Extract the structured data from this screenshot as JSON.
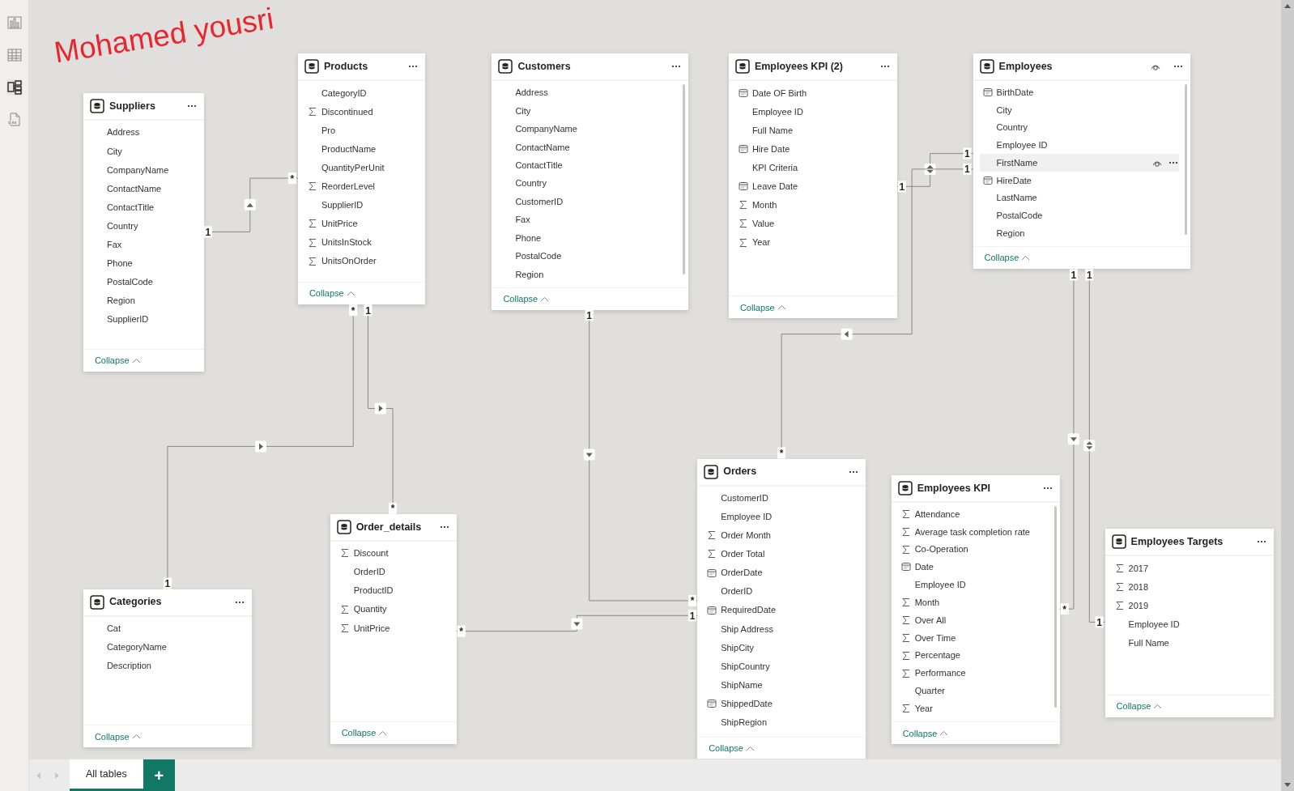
{
  "signature": "Mohamed yousri",
  "sidebar": [
    {
      "kind": "report",
      "selected": false
    },
    {
      "kind": "table",
      "selected": false
    },
    {
      "kind": "model",
      "selected": true
    },
    {
      "kind": "dax",
      "selected": false
    }
  ],
  "tables": [
    {
      "title": "Suppliers",
      "hovered": false,
      "scrollable": false,
      "collapse_label": "Collapse",
      "fields": [
        {
          "name": "Address",
          "kind": "plain",
          "hovered": false
        },
        {
          "name": "City",
          "kind": "plain",
          "hovered": false
        },
        {
          "name": "CompanyName",
          "kind": "plain",
          "hovered": false
        },
        {
          "name": "ContactName",
          "kind": "plain",
          "hovered": false
        },
        {
          "name": "ContactTitle",
          "kind": "plain",
          "hovered": false
        },
        {
          "name": "Country",
          "kind": "plain",
          "hovered": false
        },
        {
          "name": "Fax",
          "kind": "plain",
          "hovered": false
        },
        {
          "name": "Phone",
          "kind": "plain",
          "hovered": false
        },
        {
          "name": "PostalCode",
          "kind": "plain",
          "hovered": false
        },
        {
          "name": "Region",
          "kind": "plain",
          "hovered": false
        },
        {
          "name": "SupplierID",
          "kind": "plain",
          "hovered": false
        }
      ]
    },
    {
      "title": "Products",
      "hovered": false,
      "scrollable": false,
      "collapse_label": "Collapse",
      "fields": [
        {
          "name": "CategoryID",
          "kind": "plain",
          "hovered": false
        },
        {
          "name": "Discontinued",
          "kind": "sum",
          "hovered": false
        },
        {
          "name": "Pro",
          "kind": "plain",
          "hovered": false
        },
        {
          "name": "ProductName",
          "kind": "plain",
          "hovered": false
        },
        {
          "name": "QuantityPerUnit",
          "kind": "plain",
          "hovered": false
        },
        {
          "name": "ReorderLevel",
          "kind": "sum",
          "hovered": false
        },
        {
          "name": "SupplierID",
          "kind": "plain",
          "hovered": false
        },
        {
          "name": "UnitPrice",
          "kind": "sum",
          "hovered": false
        },
        {
          "name": "UnitsInStock",
          "kind": "sum",
          "hovered": false
        },
        {
          "name": "UnitsOnOrder",
          "kind": "sum",
          "hovered": false
        }
      ]
    },
    {
      "title": "Customers",
      "hovered": false,
      "scrollable": true,
      "collapse_label": "Collapse",
      "fields": [
        {
          "name": "Address",
          "kind": "plain",
          "hovered": false
        },
        {
          "name": "City",
          "kind": "plain",
          "hovered": false
        },
        {
          "name": "CompanyName",
          "kind": "plain",
          "hovered": false
        },
        {
          "name": "ContactName",
          "kind": "plain",
          "hovered": false
        },
        {
          "name": "ContactTitle",
          "kind": "plain",
          "hovered": false
        },
        {
          "name": "Country",
          "kind": "plain",
          "hovered": false
        },
        {
          "name": "CustomerID",
          "kind": "plain",
          "hovered": false
        },
        {
          "name": "Fax",
          "kind": "plain",
          "hovered": false
        },
        {
          "name": "Phone",
          "kind": "plain",
          "hovered": false
        },
        {
          "name": "PostalCode",
          "kind": "plain",
          "hovered": false
        },
        {
          "name": "Region",
          "kind": "plain",
          "hovered": false
        }
      ]
    },
    {
      "title": "Employees KPI (2)",
      "hovered": false,
      "scrollable": false,
      "collapse_label": "Collapse",
      "fields": [
        {
          "name": "Date OF Birth",
          "kind": "date",
          "hovered": false
        },
        {
          "name": "Employee ID",
          "kind": "plain",
          "hovered": false
        },
        {
          "name": "Full Name",
          "kind": "plain",
          "hovered": false
        },
        {
          "name": "Hire Date",
          "kind": "date",
          "hovered": false
        },
        {
          "name": "KPI Criteria",
          "kind": "plain",
          "hovered": false
        },
        {
          "name": "Leave Date",
          "kind": "date",
          "hovered": false
        },
        {
          "name": "Month",
          "kind": "sum",
          "hovered": false
        },
        {
          "name": "Value",
          "kind": "sum",
          "hovered": false
        },
        {
          "name": "Year",
          "kind": "sum",
          "hovered": false
        }
      ]
    },
    {
      "title": "Employees",
      "hovered": true,
      "scrollable": true,
      "collapse_label": "Collapse",
      "fields": [
        {
          "name": "BirthDate",
          "kind": "date",
          "hovered": false
        },
        {
          "name": "City",
          "kind": "plain",
          "hovered": false
        },
        {
          "name": "Country",
          "kind": "plain",
          "hovered": false
        },
        {
          "name": "Employee ID",
          "kind": "plain",
          "hovered": false
        },
        {
          "name": "FirstName",
          "kind": "plain",
          "hovered": true
        },
        {
          "name": "HireDate",
          "kind": "date",
          "hovered": false
        },
        {
          "name": "LastName",
          "kind": "plain",
          "hovered": false
        },
        {
          "name": "PostalCode",
          "kind": "plain",
          "hovered": false
        },
        {
          "name": "Region",
          "kind": "plain",
          "hovered": false
        }
      ]
    },
    {
      "title": "Categories",
      "hovered": false,
      "scrollable": false,
      "collapse_label": "Collapse",
      "fields": [
        {
          "name": "Cat",
          "kind": "plain",
          "hovered": false
        },
        {
          "name": "CategoryName",
          "kind": "plain",
          "hovered": false
        },
        {
          "name": "Description",
          "kind": "plain",
          "hovered": false
        }
      ]
    },
    {
      "title": "Order_details",
      "hovered": false,
      "scrollable": false,
      "collapse_label": "Collapse",
      "fields": [
        {
          "name": "Discount",
          "kind": "sum",
          "hovered": false
        },
        {
          "name": "OrderID",
          "kind": "plain",
          "hovered": false
        },
        {
          "name": "ProductID",
          "kind": "plain",
          "hovered": false
        },
        {
          "name": "Quantity",
          "kind": "sum",
          "hovered": false
        },
        {
          "name": "UnitPrice",
          "kind": "sum",
          "hovered": false
        }
      ]
    },
    {
      "title": "Orders",
      "hovered": false,
      "scrollable": false,
      "collapse_label": "Collapse",
      "fields": [
        {
          "name": "CustomerID",
          "kind": "plain",
          "hovered": false
        },
        {
          "name": "Employee ID",
          "kind": "plain",
          "hovered": false
        },
        {
          "name": "Order Month",
          "kind": "sum",
          "hovered": false
        },
        {
          "name": "Order Total",
          "kind": "sum",
          "hovered": false
        },
        {
          "name": "OrderDate",
          "kind": "date",
          "hovered": false
        },
        {
          "name": "OrderID",
          "kind": "plain",
          "hovered": false
        },
        {
          "name": "RequiredDate",
          "kind": "date",
          "hovered": false
        },
        {
          "name": "Ship Address",
          "kind": "plain",
          "hovered": false
        },
        {
          "name": "ShipCity",
          "kind": "plain",
          "hovered": false
        },
        {
          "name": "ShipCountry",
          "kind": "plain",
          "hovered": false
        },
        {
          "name": "ShipName",
          "kind": "plain",
          "hovered": false
        },
        {
          "name": "ShippedDate",
          "kind": "date",
          "hovered": false
        },
        {
          "name": "ShipRegion",
          "kind": "plain",
          "hovered": false
        }
      ]
    },
    {
      "title": "Employees KPI",
      "hovered": false,
      "scrollable": true,
      "collapse_label": "Collapse",
      "fields": [
        {
          "name": "Attendance",
          "kind": "sum",
          "hovered": false
        },
        {
          "name": "Average task completion rate",
          "kind": "sum",
          "hovered": false
        },
        {
          "name": "Co-Operation",
          "kind": "sum",
          "hovered": false
        },
        {
          "name": "Date",
          "kind": "date",
          "hovered": false
        },
        {
          "name": "Employee ID",
          "kind": "plain",
          "hovered": false
        },
        {
          "name": "Month",
          "kind": "sum",
          "hovered": false
        },
        {
          "name": "Over All",
          "kind": "sum",
          "hovered": false
        },
        {
          "name": "Over Time",
          "kind": "sum",
          "hovered": false
        },
        {
          "name": "Percentage",
          "kind": "sum",
          "hovered": false
        },
        {
          "name": "Performance",
          "kind": "sum",
          "hovered": false
        },
        {
          "name": "Quarter",
          "kind": "plain",
          "hovered": false
        },
        {
          "name": "Year",
          "kind": "sum",
          "hovered": false
        }
      ]
    },
    {
      "title": "Employees Targets",
      "hovered": false,
      "scrollable": false,
      "collapse_label": "Collapse",
      "fields": [
        {
          "name": "2017",
          "kind": "sum",
          "hovered": false
        },
        {
          "name": "2018",
          "kind": "sum",
          "hovered": false
        },
        {
          "name": "2019",
          "kind": "sum",
          "hovered": false
        },
        {
          "name": "Employee ID",
          "kind": "plain",
          "hovered": false
        },
        {
          "name": "Full Name",
          "kind": "plain",
          "hovered": false
        }
      ]
    }
  ],
  "relationships": [
    {
      "end_a": "1",
      "end_b": "*",
      "bidirectional": false
    },
    {
      "end_a": "*",
      "end_b": "1",
      "bidirectional": false
    },
    {
      "end_a": "1",
      "end_b": "*",
      "bidirectional": false
    },
    {
      "end_a": "1",
      "end_b": "*",
      "bidirectional": false
    },
    {
      "end_a": "*",
      "end_b": "1",
      "bidirectional": false
    },
    {
      "end_a": "1",
      "end_b": "1",
      "bidirectional": true
    },
    {
      "end_a": "1",
      "end_b": "*",
      "bidirectional": false
    },
    {
      "end_a": "1",
      "end_b": "*",
      "bidirectional": false
    },
    {
      "end_a": "1",
      "end_b": "1",
      "bidirectional": true
    }
  ],
  "bottom_tabs": [
    {
      "label": "All tables",
      "selected": true
    }
  ],
  "add_tab_label": "+"
}
